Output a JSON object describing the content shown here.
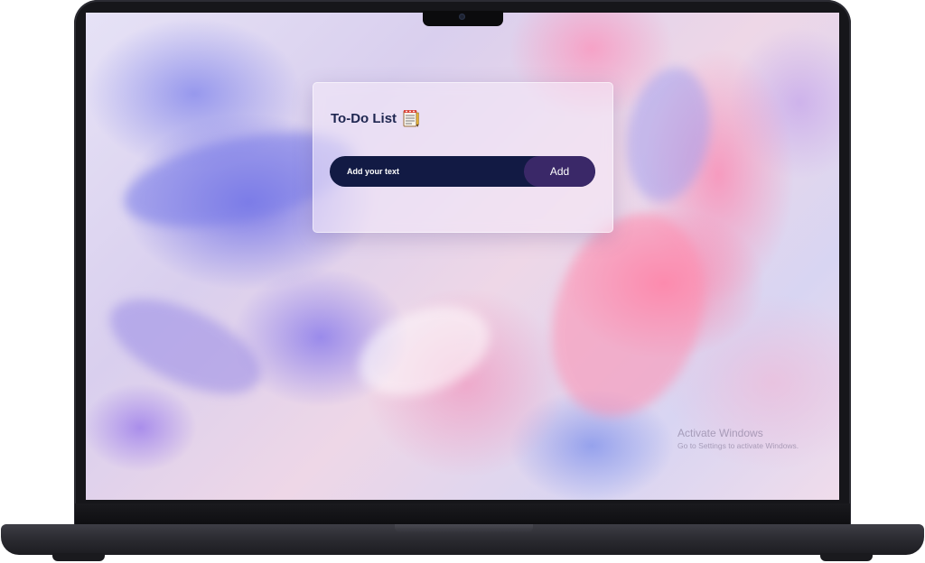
{
  "todo_card": {
    "title": "To-Do List",
    "title_icon": "notepad-icon",
    "input_placeholder": "Add your text",
    "input_value": "",
    "add_button_label": "Add"
  },
  "watermark": {
    "title": "Activate Windows",
    "subtitle": "Go to Settings to activate Windows."
  },
  "colors": {
    "title_text": "#1e2650",
    "input_background": "#121a44",
    "add_button_background": "#3a2868",
    "laptop_body": "#16161a"
  }
}
